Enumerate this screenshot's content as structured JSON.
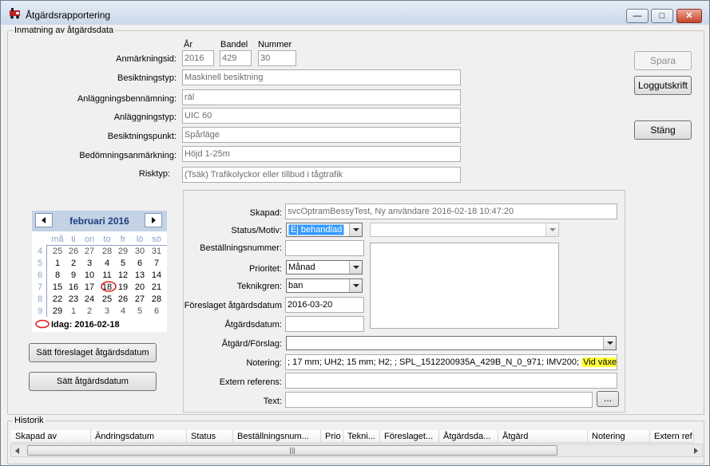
{
  "window": {
    "title": "Åtgärdsrapportering",
    "minimize": "—",
    "maximize": "□",
    "close": "✕"
  },
  "group_input": {
    "legend": "Inmatning av åtgärdsdata",
    "col_year": "År",
    "col_line": "Bandel",
    "col_number": "Nummer",
    "anm_label": "Anmärkningsid:",
    "anm_year": "2016",
    "anm_line": "429",
    "anm_number": "30",
    "besiktningstyp_label": "Besiktningstyp:",
    "besiktningstyp": "Maskinell besiktning",
    "anlbenamning_label": "Anläggningsbennämning:",
    "anlbenamning": "räl",
    "anltyp_label": "Anläggningstyp:",
    "anltyp": "UIC 60",
    "bespunkt_label": "Besiktningspunkt:",
    "bespunkt": "Spårläge",
    "bedanm_label": "Bedömningsanmärkning:",
    "bedanm": "Höjd 1-25m",
    "risktyp_label": "Risktyp:",
    "risktyp": "(Tsäk) Trafikolyckor eller tillbud i tågtrafik"
  },
  "buttons": {
    "spara": "Spara",
    "loggutskrift": "Loggutskrift",
    "stang": "Stäng",
    "satt_foreslaget": "Sätt föreslaget åtgärdsdatum",
    "satt_atgard": "Sätt åtgärdsdatum",
    "text_browse": "..."
  },
  "calendar": {
    "month_label": "februari 2016",
    "dow": [
      "må",
      "ti",
      "on",
      "to",
      "fr",
      "lö",
      "sö"
    ],
    "weeks": [
      {
        "wk": "4",
        "days": [
          "25",
          "26",
          "27",
          "28",
          "29",
          "30",
          "31"
        ],
        "other": [
          true,
          true,
          true,
          true,
          true,
          true,
          true
        ]
      },
      {
        "wk": "5",
        "days": [
          "1",
          "2",
          "3",
          "4",
          "5",
          "6",
          "7"
        ],
        "other": [
          false,
          false,
          false,
          false,
          false,
          false,
          false
        ]
      },
      {
        "wk": "6",
        "days": [
          "8",
          "9",
          "10",
          "11",
          "12",
          "13",
          "14"
        ],
        "other": [
          false,
          false,
          false,
          false,
          false,
          false,
          false
        ]
      },
      {
        "wk": "7",
        "days": [
          "15",
          "16",
          "17",
          "18",
          "19",
          "20",
          "21"
        ],
        "other": [
          false,
          false,
          false,
          false,
          false,
          false,
          false
        ]
      },
      {
        "wk": "8",
        "days": [
          "22",
          "23",
          "24",
          "25",
          "26",
          "27",
          "28"
        ],
        "other": [
          false,
          false,
          false,
          false,
          false,
          false,
          false
        ]
      },
      {
        "wk": "9",
        "days": [
          "29",
          "1",
          "2",
          "3",
          "4",
          "5",
          "6"
        ],
        "other": [
          false,
          true,
          true,
          true,
          true,
          true,
          true
        ]
      }
    ],
    "today_label": "Idag: 2016-02-18"
  },
  "details": {
    "skapad_label": "Skapad:",
    "skapad": "svcOptramBessyTest, Ny användare   2016-02-18 10:47:20",
    "status_label": "Status/Motiv:",
    "status": "Ej behandlad",
    "motiv": "",
    "bestnr_label": "Beställningsnummer:",
    "bestnr": "",
    "prioritet_label": "Prioritet:",
    "prioritet": "Månad",
    "teknikgren_label": "Teknikgren:",
    "teknikgren": "ban",
    "foreslaget_label": "Föreslaget åtgärdsdatum",
    "foreslaget": "2016-03-20",
    "atgardsdatum_label": "Åtgärdsdatum:",
    "atgardsdatum": "",
    "atgard_label": "Åtgärd/Förslag:",
    "atgard": "",
    "notering_label": "Notering:",
    "notering_main": "; 17 mm; UH2; 15 mm; H2; ; SPL_1512200935A_429B_N_0_971; IMV200;",
    "notering_highlight": "Vid växel;",
    "extern_label": "Extern referens:",
    "extern": "",
    "text_label": "Text:",
    "text": ""
  },
  "history": {
    "legend": "Historik",
    "columns": [
      "Skapad av",
      "Ändringsdatum",
      "Status",
      "Beställningsnum...",
      "Prio",
      "Tekni...",
      "Föreslaget...",
      "Åtgärdsda...",
      "Åtgärd",
      "Notering",
      "Extern ref"
    ],
    "scroll_grip": "|||"
  },
  "colors": {
    "highlight": "#ffff3a",
    "selection": "#3399ff",
    "annotation": "#e02020"
  }
}
